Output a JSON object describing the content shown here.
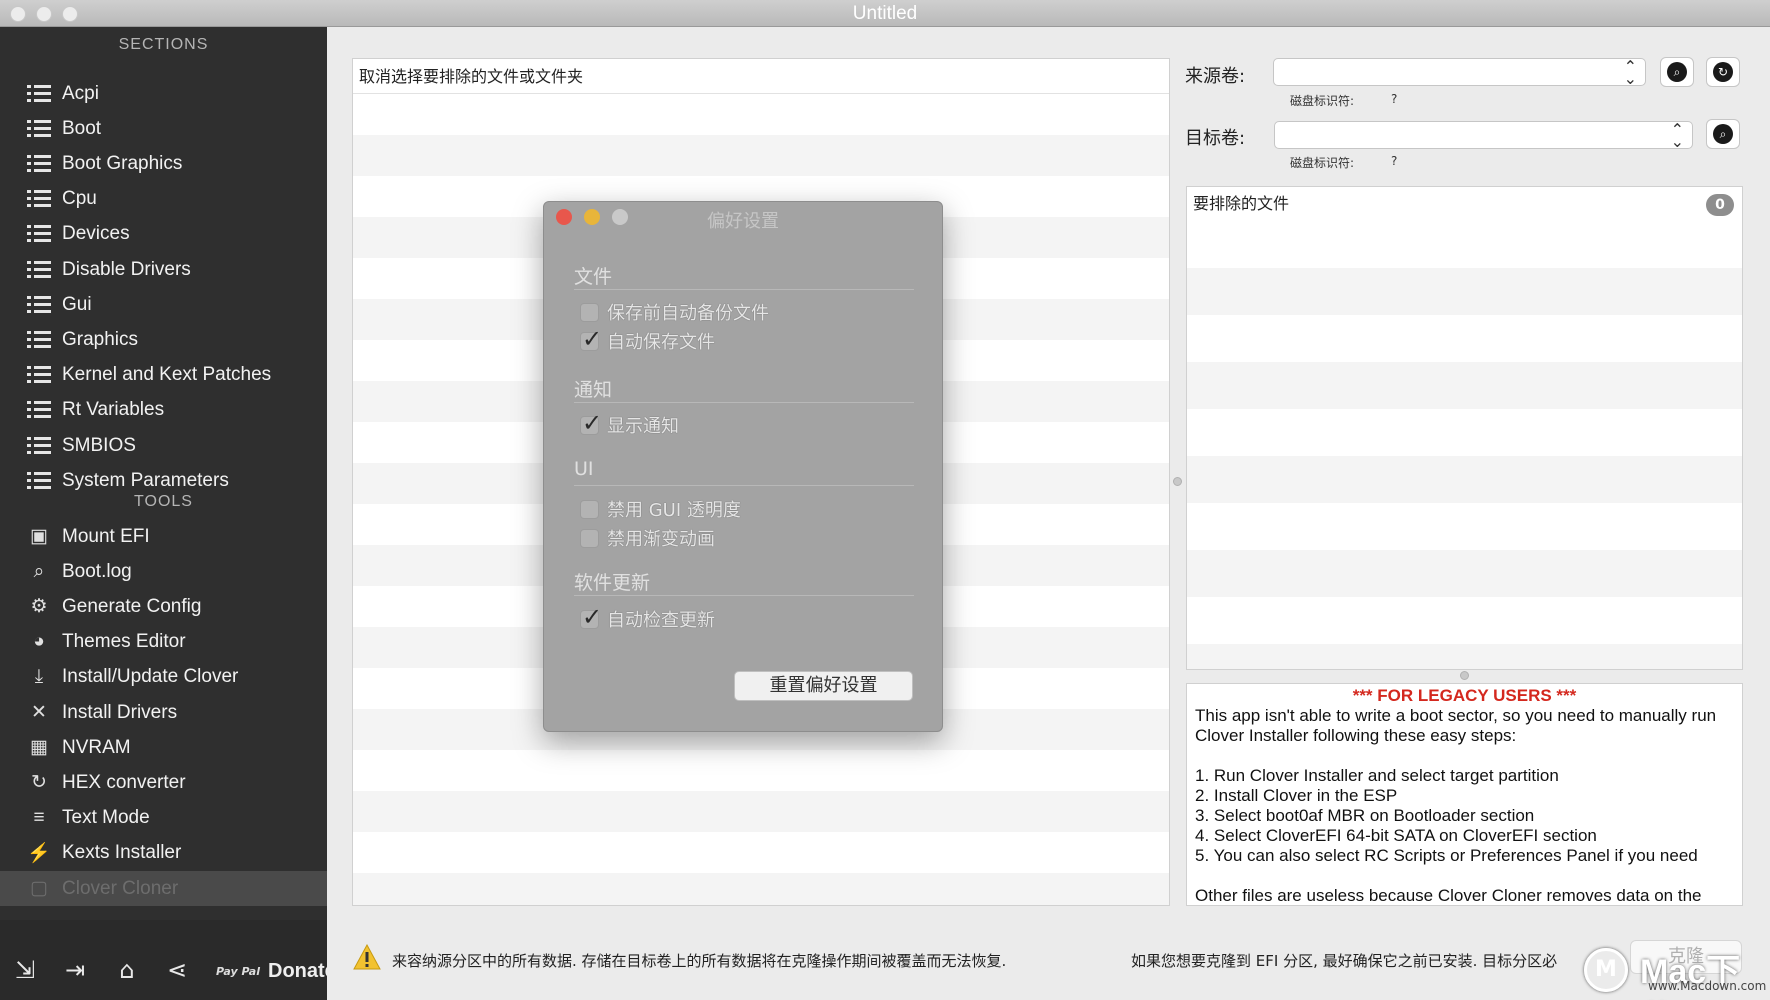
{
  "window": {
    "title": "Untitled"
  },
  "sidebar": {
    "sections_header": "SECTIONS",
    "sections": [
      {
        "label": "Acpi"
      },
      {
        "label": "Boot"
      },
      {
        "label": "Boot Graphics"
      },
      {
        "label": "Cpu"
      },
      {
        "label": "Devices"
      },
      {
        "label": "Disable Drivers"
      },
      {
        "label": "Gui"
      },
      {
        "label": "Graphics"
      },
      {
        "label": "Kernel and Kext Patches"
      },
      {
        "label": "Rt Variables"
      },
      {
        "label": "SMBIOS"
      },
      {
        "label": "System Parameters"
      }
    ],
    "tools_header": "TOOLS",
    "tools": [
      {
        "label": "Mount EFI",
        "icon": "disk-icon"
      },
      {
        "label": "Boot.log",
        "icon": "log-search-icon"
      },
      {
        "label": "Generate Config",
        "icon": "gears-icon"
      },
      {
        "label": "Themes Editor",
        "icon": "palette-icon"
      },
      {
        "label": "Install/Update Clover",
        "icon": "download-icon"
      },
      {
        "label": "Install Drivers",
        "icon": "wrench-icon"
      },
      {
        "label": "NVRAM",
        "icon": "chip-icon"
      },
      {
        "label": "HEX converter",
        "icon": "refresh-icon"
      },
      {
        "label": "Text Mode",
        "icon": "text-lines-icon"
      },
      {
        "label": "Kexts Installer",
        "icon": "plug-icon"
      },
      {
        "label": "Clover Cloner",
        "icon": "copy-icon"
      }
    ],
    "bottom": {
      "donate_label": "Donate",
      "paypal_label": "Pay Pal"
    }
  },
  "exclude_pane": {
    "header": "取消选择要排除的文件或文件夹"
  },
  "volumes": {
    "source_label": "来源卷:",
    "target_label": "目标卷:",
    "disk_id_label": "磁盘标识符:",
    "source_disk_id": "?",
    "target_disk_id": "?"
  },
  "excluded_files": {
    "header": "要排除的文件",
    "count": "0"
  },
  "legacy": {
    "title": "*** FOR LEGACY USERS ***",
    "intro": "This app isn't able to write a boot sector, so you need to manually run Clover Installer following these easy steps:",
    "steps": [
      "1. Run Clover Installer and select target partition",
      "2. Install Clover in the ESP",
      "3. Select boot0af MBR on Bootloader section",
      "4. Select CloverEFI 64-bit SATA on CloverEFI section",
      "5. You can also select RC Scripts or Preferences Panel if you need"
    ],
    "footer": "Other files are useless because Clover Cloner removes data on the"
  },
  "status": {
    "warning": "来容纳源分区中的所有数据. 存储在目标卷上的所有数据将在克隆操作期间被覆盖而无法恢复.",
    "efi_note": "如果您想要克隆到 EFI 分区, 最好确保它之前已安装. 目标分区必",
    "clone_button": "克隆"
  },
  "watermark": {
    "text": "Mac下载",
    "sub": "www.Macdown.com",
    "logo": "M"
  },
  "prefs": {
    "title": "偏好设置",
    "sections": [
      {
        "title": "文件",
        "options": [
          {
            "label": "保存前自动备份文件",
            "checked": false
          },
          {
            "label": "自动保存文件",
            "checked": true
          }
        ]
      },
      {
        "title": "通知",
        "options": [
          {
            "label": "显示通知",
            "checked": true
          }
        ]
      },
      {
        "title": "UI",
        "options": [
          {
            "label": "禁用 GUI 透明度",
            "checked": false
          },
          {
            "label": "禁用渐变动画",
            "checked": false
          }
        ]
      },
      {
        "title": "软件更新",
        "options": [
          {
            "label": "自动检查更新",
            "checked": true
          }
        ]
      }
    ],
    "reset_button": "重置偏好设置"
  },
  "colors": {
    "legacy_title": "#d4281e",
    "sidebar_bg": "#2f2f2f",
    "dialog_bg": "#a3a3a3"
  }
}
